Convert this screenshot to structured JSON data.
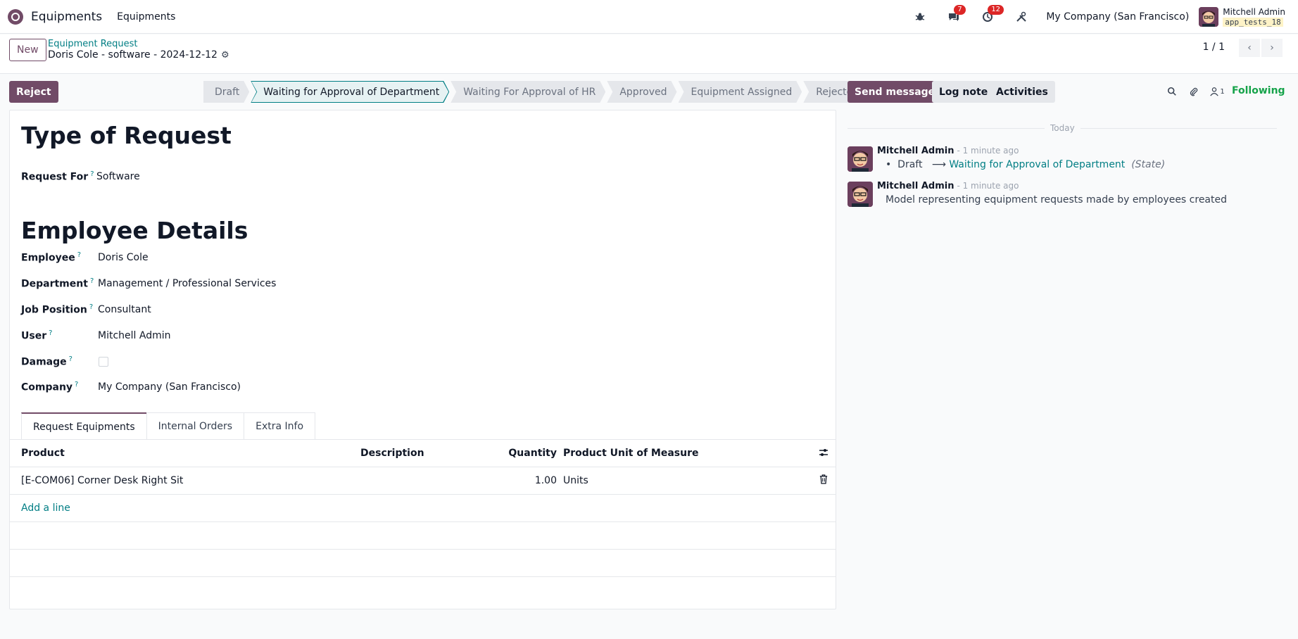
{
  "navbar": {
    "app_name": "Equipments",
    "menu_item": "Equipments",
    "messages_count": "7",
    "activities_count": "12",
    "company": "My Company (San Francisco)",
    "user_name": "Mitchell Admin",
    "db_name": "app_tests_18"
  },
  "control": {
    "new_label": "New",
    "breadcrumb_parent": "Equipment Request",
    "breadcrumb_current": "Doris Cole - software - 2024-12-12",
    "pager": "1 / 1"
  },
  "statusbar": {
    "reject_label": "Reject",
    "stages": [
      "Draft",
      "Waiting for Approval of Department",
      "Waiting For Approval of HR",
      "Approved",
      "Equipment Assigned",
      "Rejected"
    ],
    "active_stage": "Waiting for Approval of Department"
  },
  "form": {
    "section1_title": "Type of Request",
    "request_for_label": "Request For",
    "request_for_value": "Software",
    "section2_title": "Employee Details",
    "employee_label": "Employee",
    "employee_value": "Doris Cole",
    "department_label": "Department",
    "department_value": "Management / Professional Services",
    "job_label": "Job Position",
    "job_value": "Consultant",
    "user_label": "User",
    "user_value": "Mitchell Admin",
    "damage_label": "Damage",
    "damage_checked": false,
    "company_label": "Company",
    "company_value": "My Company (San Francisco)",
    "help_marker": "?"
  },
  "tabs": [
    "Request Equipments",
    "Internal Orders",
    "Extra Info"
  ],
  "table": {
    "columns": [
      "Product",
      "Description",
      "Quantity",
      "Product Unit of Measure"
    ],
    "rows": [
      {
        "product": "[E-COM06] Corner Desk Right Sit",
        "description": "",
        "quantity": "1.00",
        "uom": "Units"
      }
    ],
    "add_line": "Add a line"
  },
  "chatter": {
    "send_message": "Send message",
    "log_note": "Log note",
    "activities": "Activities",
    "followers_count": "1",
    "following": "Following",
    "date_separator": "Today",
    "messages": [
      {
        "author": "Mitchell Admin",
        "time": "- 1 minute ago",
        "from_state": "Draft",
        "arrow": "⟶",
        "to_state": "Waiting for Approval of Department",
        "field": "(State)"
      },
      {
        "author": "Mitchell Admin",
        "time": "- 1 minute ago",
        "body": "Model representing equipment requests made by employees created"
      }
    ]
  },
  "colors": {
    "brand": "#714b67",
    "teal": "#017e84",
    "following": "#16a34a",
    "badge": "#dc2626"
  }
}
